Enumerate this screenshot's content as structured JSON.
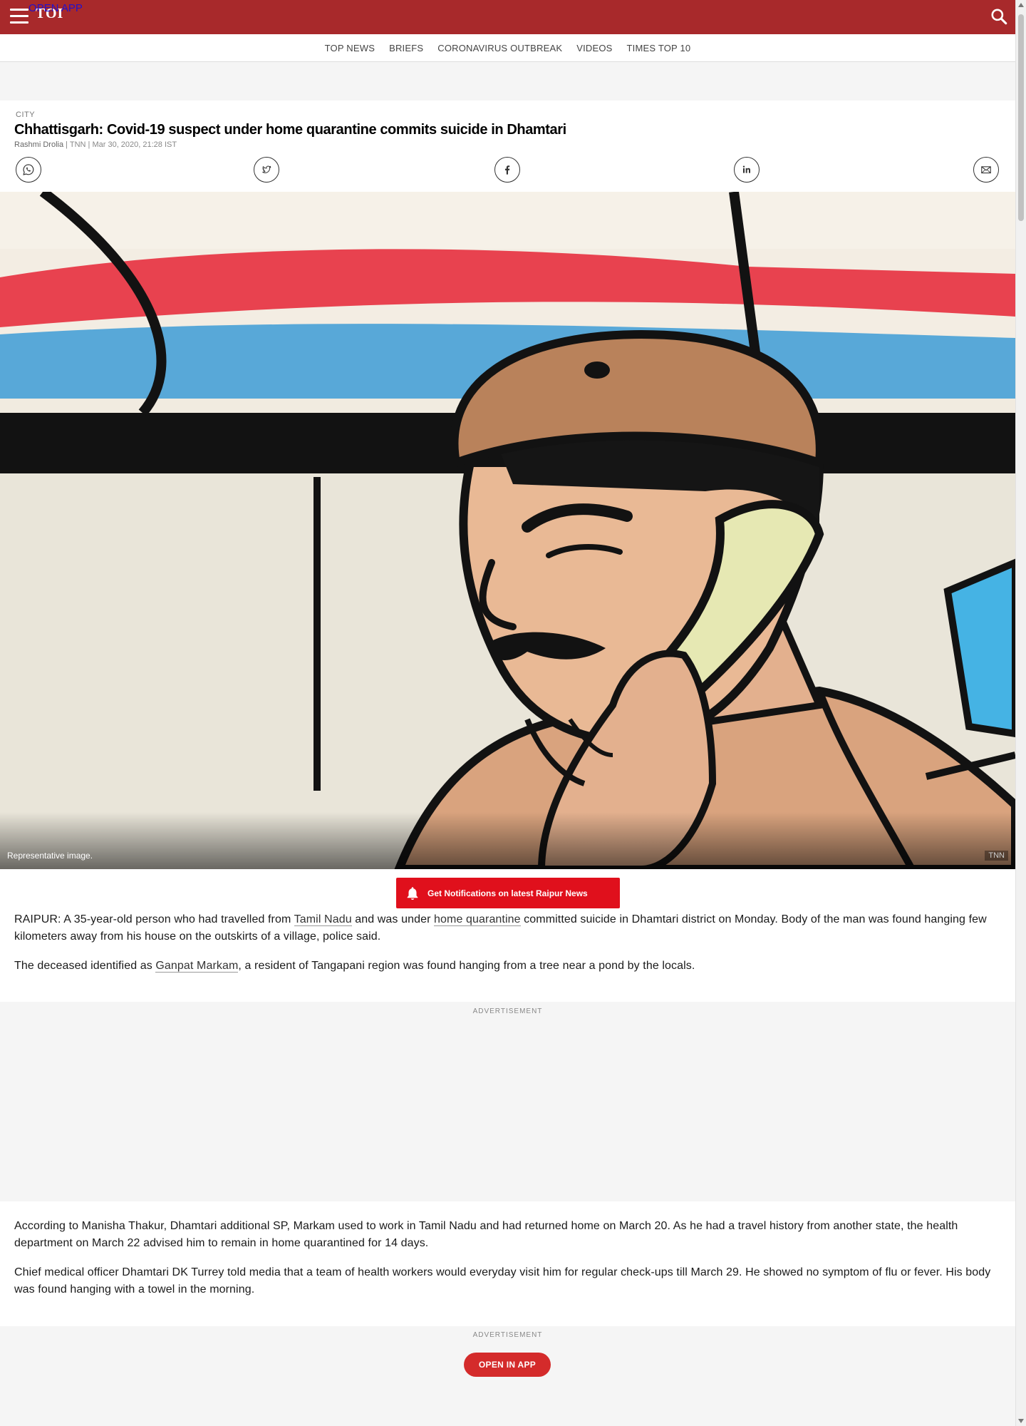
{
  "header": {
    "logo_text": "TOI",
    "open_app_label": "OPEN APP",
    "icons": [
      "menu-icon",
      "search-icon"
    ],
    "brand_color": "#a8292b"
  },
  "nav": {
    "items": [
      "TOP NEWS",
      "BRIEFS",
      "CORONAVIRUS OUTBREAK",
      "VIDEOS",
      "TIMES TOP 10"
    ]
  },
  "article": {
    "category": "CITY",
    "headline": "Chhattisgarh: Covid-19 suspect under home quarantine commits suicide in Dhamtari",
    "author": "Rashmi Drolia",
    "agency": "TNN",
    "timestamp": "Mar 30, 2020, 21:28 IST",
    "share_icons": [
      "whatsapp-icon",
      "twitter-icon",
      "facebook-icon",
      "linkedin-icon",
      "email-icon"
    ],
    "image": {
      "caption": "Representative image.",
      "credit": "TNN"
    },
    "notification_cta": "Get Notifications on latest Raipur News",
    "p1": {
      "t1": "RAIPUR: A 35-year-old person who had travelled from ",
      "link1": "Tamil Nadu",
      "t2": " and was under ",
      "link2": "home quarantine",
      "t3": " committed suicide in Dhamtari district on Monday. Body of the man was found hanging few kilometers away from his house on the outskirts of a village, police said."
    },
    "p2": {
      "t1": "The deceased identified as ",
      "link1": "Ganpat Markam",
      "t2": ", a resident of Tangapani region was found hanging from a tree near a pond by the locals."
    },
    "p3": "According to Manisha Thakur, Dhamtari additional SP, Markam used to work in Tamil Nadu and had returned home on March 20. As he had a travel history from another state, the health department on March 22 advised him to remain in home quarantined for 14 days.",
    "p4": "Chief medical officer Dhamtari DK Turrey told media that a team of health workers would everyday visit him for regular check-ups till March 29. He showed no symptom of flu or fever. His body was found hanging with a towel in the morning."
  },
  "ads": {
    "label": "ADVERTISEMENT"
  },
  "footer": {
    "open_in_app_label": "OPEN IN APP",
    "cta_color": "#d42b2b"
  }
}
